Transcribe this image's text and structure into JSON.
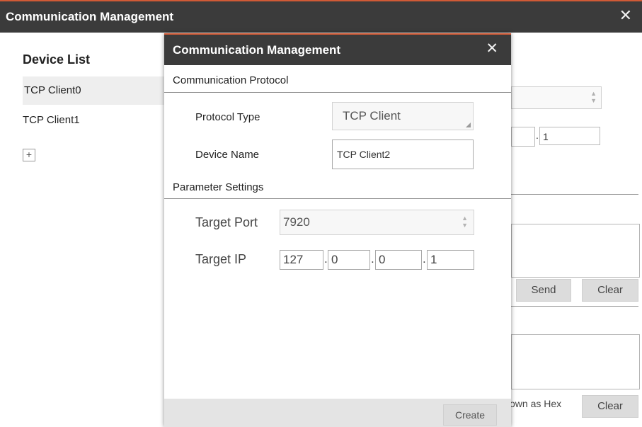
{
  "main_window": {
    "title": "Communication Management",
    "close_glyph": "✕"
  },
  "device_list": {
    "title": "Device List",
    "items": [
      {
        "label": "TCP Client0",
        "selected": true
      },
      {
        "label": "TCP Client1",
        "selected": false
      }
    ],
    "add_glyph": "+"
  },
  "background_panel": {
    "ip_last_octet": "1",
    "send_label": "Send",
    "clear_label": "Clear",
    "hex_label": "own as Hex",
    "clear2_label": "Clear"
  },
  "dialog": {
    "title": "Communication Management",
    "close_glyph": "✕",
    "section_protocol": "Communication Protocol",
    "protocol_type_label": "Protocol Type",
    "protocol_type_value": "TCP Client",
    "device_name_label": "Device Name",
    "device_name_value": "TCP Client2",
    "section_params": "Parameter Settings",
    "target_port_label": "Target Port",
    "target_port_value": "7920",
    "target_ip_label": "Target IP",
    "target_ip": [
      "127",
      "0",
      "0",
      "1"
    ],
    "create_label": "Create"
  },
  "colors": {
    "titlebar": "#3b3b3b",
    "accent": "#d05a36",
    "selected_row": "#eeeeee",
    "button_gray": "#dcdcdc"
  }
}
